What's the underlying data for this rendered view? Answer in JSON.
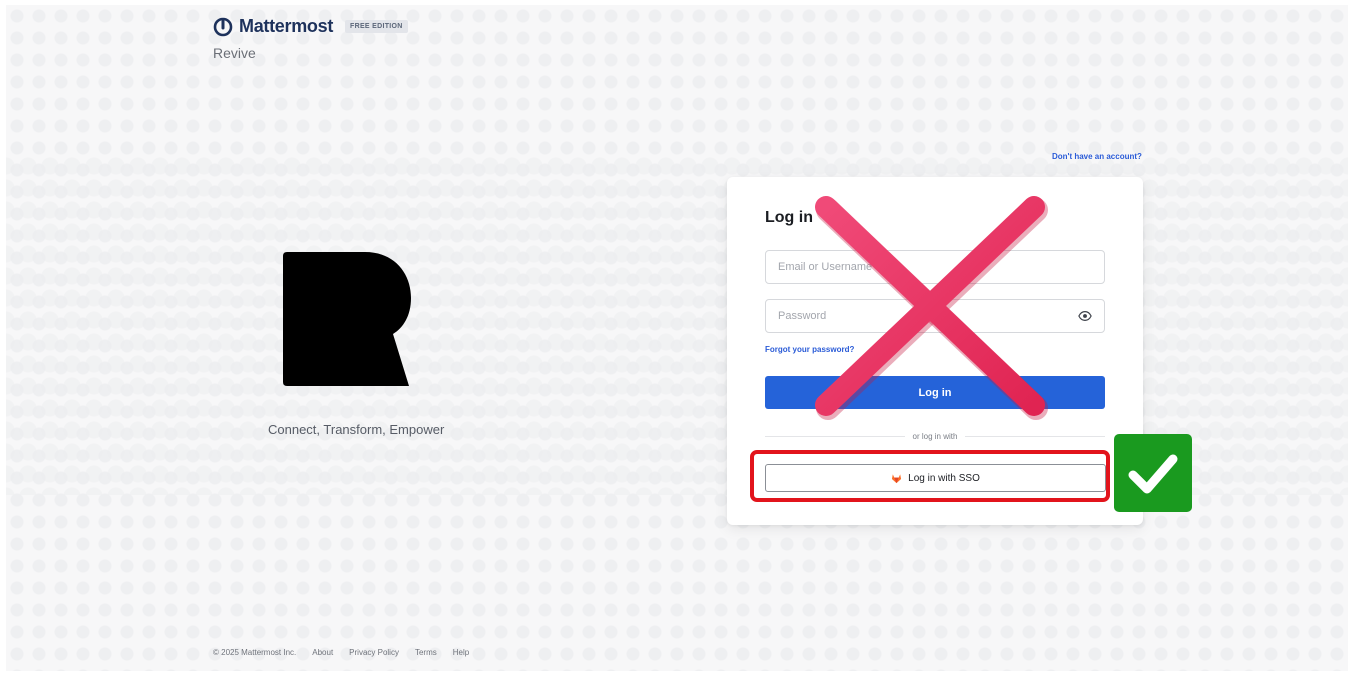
{
  "header": {
    "brand_name": "Mattermost",
    "edition": "FREE EDITION",
    "workspace": "Revive"
  },
  "hero": {
    "logo_icon": "revive-r-logo",
    "tagline": "Connect, Transform, Empower"
  },
  "signup": {
    "link_text": "Don't have an account?"
  },
  "login_card": {
    "title": "Log in",
    "email_placeholder": "Email or Username",
    "password_placeholder": "Password",
    "forgot_password": "Forgot your password?",
    "login_button": "Log in",
    "divider_text": "or log in with",
    "sso_button": "Log in with SSO",
    "sso_icon": "gitlab-icon"
  },
  "annotations": {
    "cross_color": "#e8335e",
    "highlight_color": "#e2141c",
    "check_color": "#1a9a1f"
  },
  "footer": {
    "copyright": "© 2025 Mattermost Inc.",
    "links": [
      "About",
      "Privacy Policy",
      "Terms",
      "Help"
    ]
  },
  "colors": {
    "primary": "#2563d9",
    "brand_text": "#1e325c"
  }
}
